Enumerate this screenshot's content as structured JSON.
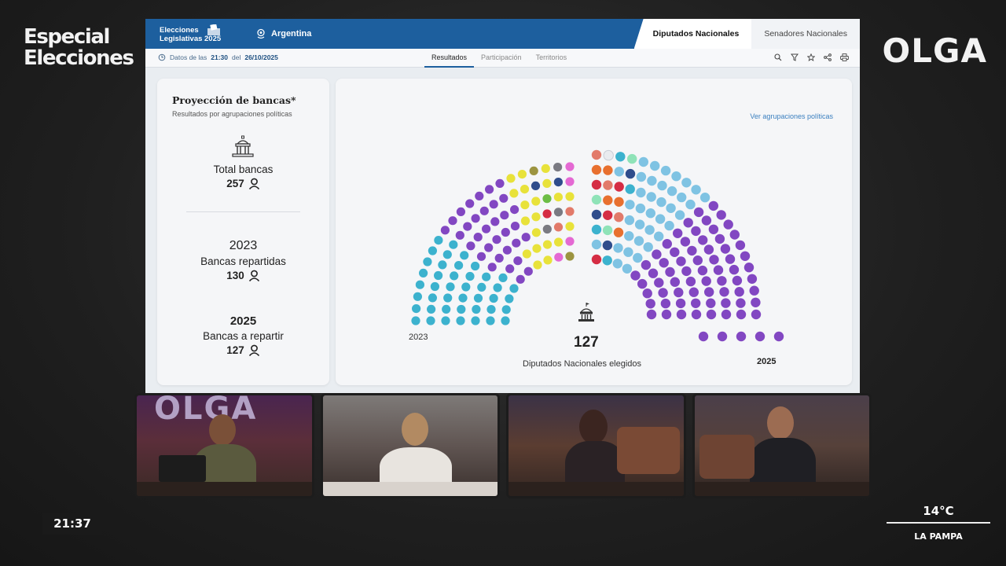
{
  "overlay": {
    "brand_left_line1": "Especial",
    "brand_left_line2": "Elecciones",
    "brand_right": "OLGA",
    "clock": "21:37",
    "temperature": "14°C",
    "location": "LA PAMPA"
  },
  "header": {
    "title_line1": "Elecciones",
    "title_line2": "Legislativas 2025",
    "country": "Argentina",
    "chamber_tabs": [
      {
        "label": "Diputados Nacionales",
        "active": true
      },
      {
        "label": "Senadores Nacionales",
        "active": false
      }
    ]
  },
  "subbar": {
    "updated_prefix": "Datos de las",
    "updated_time": "21:30",
    "updated_mid": "del",
    "updated_date": "26/10/2025",
    "tabs": [
      {
        "label": "Resultados",
        "active": true
      },
      {
        "label": "Participación",
        "active": false
      },
      {
        "label": "Territorios",
        "active": false
      }
    ],
    "tools": [
      "search-icon",
      "filter-icon",
      "star-icon",
      "share-icon",
      "print-icon"
    ]
  },
  "summary": {
    "title": "Proyección de bancas*",
    "subtitle": "Resultados por agrupaciones políticas",
    "total_label": "Total bancas",
    "total_value": "257",
    "y2023": "2023",
    "y2023_label": "Bancas repartidas",
    "y2023_value": "130",
    "y2025": "2025",
    "y2025_label": "Bancas a repartir",
    "y2025_value": "127"
  },
  "hemicycle": {
    "link": "Ver agrupaciones políticas",
    "left_year": "2023",
    "right_year": "2025",
    "total": "127",
    "total_label": "Diputados Nacionales elegidos",
    "colors": {
      "teal": "#3cb2ce",
      "violet": "#8247c2",
      "yellow": "#e8e23a",
      "lightblue": "#7fc3e3",
      "orange": "#e8702f",
      "red": "#d52d44",
      "navy": "#2f4d8c",
      "pink": "#e469d3",
      "gray": "#7a7a82",
      "green": "#6cbd45",
      "olive": "#9c9440",
      "salmon": "#e27a6a",
      "mint": "#8fe3b8",
      "white": "#e9ebef"
    }
  }
}
